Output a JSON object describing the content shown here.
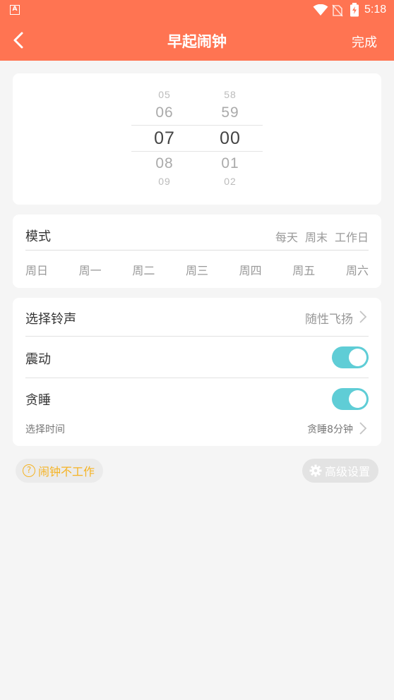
{
  "status_bar": {
    "app_badge": "A",
    "time": "5:18"
  },
  "header": {
    "title": "早起闹钟",
    "done": "完成"
  },
  "time_picker": {
    "hours": [
      "05",
      "06",
      "07",
      "08",
      "09"
    ],
    "minutes": [
      "58",
      "59",
      "00",
      "01",
      "02"
    ]
  },
  "mode": {
    "label": "模式",
    "quick": [
      "每天",
      "周末",
      "工作日"
    ],
    "days": [
      "周日",
      "周一",
      "周二",
      "周三",
      "周四",
      "周五",
      "周六"
    ]
  },
  "settings": {
    "ringtone_label": "选择铃声",
    "ringtone_value": "随性飞扬",
    "vibrate_label": "震动",
    "vibrate_on": true,
    "snooze_label": "贪睡",
    "snooze_on": true,
    "snooze_time_label": "选择时间",
    "snooze_time_value": "贪睡8分钟"
  },
  "footer": {
    "help": "闹钟不工作",
    "advanced": "高级设置"
  },
  "colors": {
    "accent": "#ff7452",
    "toggle": "#5fcdd6",
    "help": "#f5b324"
  }
}
